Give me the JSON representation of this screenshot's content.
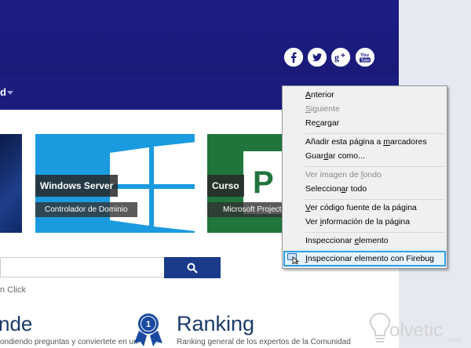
{
  "nav": {
    "label": "d"
  },
  "social": [
    {
      "name": "facebook-icon",
      "glyph": "f"
    },
    {
      "name": "twitter-icon",
      "glyph": ""
    },
    {
      "name": "google-plus-icon",
      "glyph": "g+"
    },
    {
      "name": "youtube-icon",
      "glyph": "You"
    }
  ],
  "tiles": {
    "windows_server": {
      "title": "Windows Server",
      "subtitle": "Controlador de Dominio"
    },
    "curso": {
      "title": "Curso",
      "subtitle": "Microsoft Project",
      "logo_letter": "P"
    }
  },
  "search": {
    "placeholder": "",
    "button_icon": "search-icon"
  },
  "click_text": "n Click",
  "sections": {
    "left": {
      "title": "nde",
      "subtitle": "ondiendo preguntas y conviertete en un"
    },
    "ranking": {
      "title": "Ranking",
      "subtitle": "Ranking general de los expertos de la Comunidad",
      "medal_number": "1"
    }
  },
  "context_menu": {
    "items": [
      {
        "label": "Anterior",
        "enabled": true
      },
      {
        "label": "Siguiente",
        "enabled": false
      },
      {
        "label": "Recargar",
        "enabled": true
      },
      {
        "label": "Añadir esta página a marcadores",
        "enabled": true
      },
      {
        "label": "Guardar como...",
        "enabled": true
      },
      {
        "label": "Ver imagen de fondo",
        "enabled": false
      },
      {
        "label": "Seleccionar todo",
        "enabled": true
      },
      {
        "label": "Ver código fuente de la página",
        "enabled": true
      },
      {
        "label": "Ver información de la página",
        "enabled": true
      },
      {
        "label": "Inspeccionar elemento",
        "enabled": true
      },
      {
        "label": "Inspeccionar elemento con Firebug",
        "enabled": true,
        "highlighted": true
      }
    ]
  },
  "watermark": {
    "text": "olvetic",
    "suffix": ".com"
  },
  "colors": {
    "header": "#1c1e86",
    "accent": "#2e9ee6",
    "windows_tile": "#1a9be0",
    "project_tile": "#20753c"
  }
}
